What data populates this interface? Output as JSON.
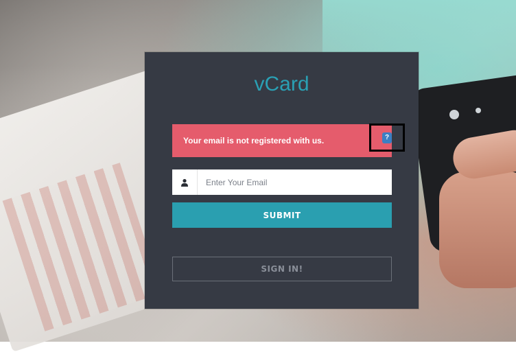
{
  "app": {
    "title": "vCard"
  },
  "alert": {
    "message": "Your email is not registered with us.",
    "close_glyph": "?"
  },
  "email_field": {
    "placeholder": "Enter Your Email",
    "value": "",
    "icon": "user-icon"
  },
  "buttons": {
    "submit_label": "SUBMIT",
    "signin_label": "SIGN IN!"
  },
  "colors": {
    "accent": "#2aa0b4",
    "alert": "#e55c6c",
    "panel": "#363a44"
  }
}
